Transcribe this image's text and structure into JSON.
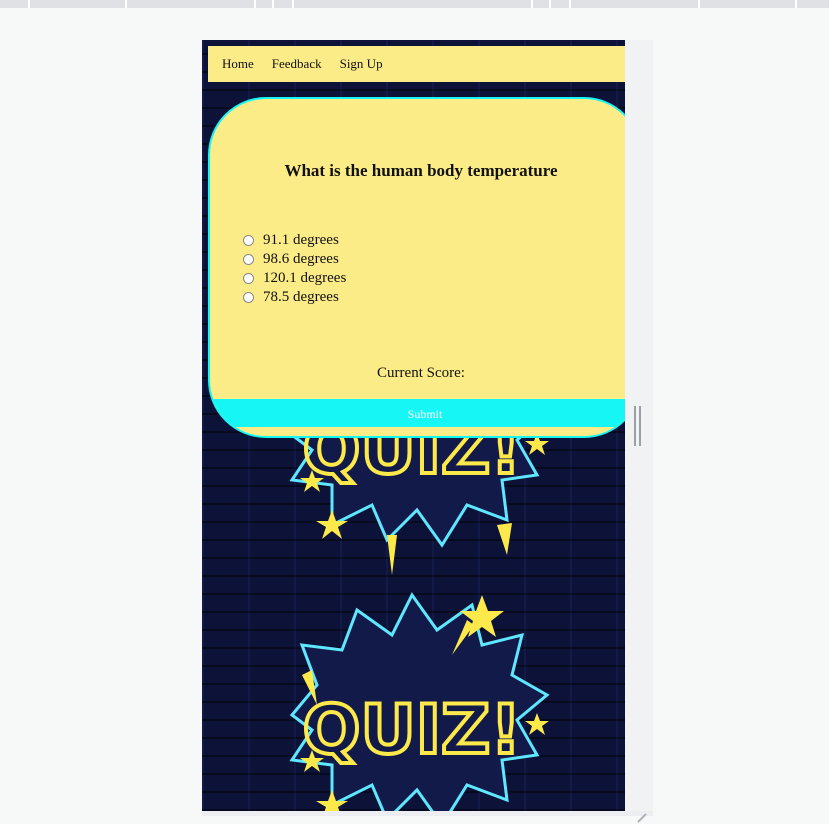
{
  "nav": {
    "items": [
      "Home",
      "Feedback",
      "Sign Up"
    ]
  },
  "quiz": {
    "question": "What is the human body temperature",
    "options": [
      "91.1 degrees",
      "98.6 degrees",
      "120.1 degrees",
      "78.5 degrees"
    ],
    "score_label": "Current Score:",
    "submit_label": "Submit"
  },
  "background": {
    "art_text": "QUIZ!"
  },
  "colors": {
    "card": "#fcec87",
    "accent": "#16f6f4",
    "wall": "#0c1238",
    "art_yellow": "#fde94a",
    "art_outline": "#5ee7ff"
  }
}
